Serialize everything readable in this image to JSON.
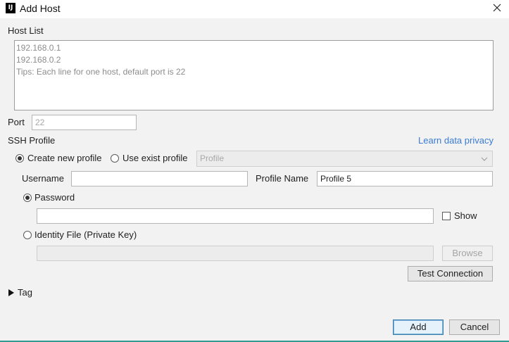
{
  "window": {
    "title": "Add Host",
    "app_icon_text": "IJ",
    "close_icon": "close-icon"
  },
  "host_list": {
    "label": "Host List",
    "lines": [
      "192.168.0.1",
      "192.168.0.2",
      "Tips: Each line for one host, default port is 22"
    ]
  },
  "port": {
    "label": "Port",
    "placeholder": "22"
  },
  "ssh_profile": {
    "label": "SSH Profile",
    "learn_link": "Learn data privacy",
    "create_new_label": "Create new profile",
    "create_new_selected": true,
    "use_exist_label": "Use exist profile",
    "use_exist_selected": false,
    "profile_select_value": "Profile"
  },
  "username": {
    "label": "Username",
    "value": ""
  },
  "profile_name": {
    "label": "Profile Name",
    "value": "Profile 5"
  },
  "auth": {
    "password_label": "Password",
    "password_selected": true,
    "password_value": "",
    "show_label": "Show",
    "show_checked": false,
    "identity_label": "Identity File (Private Key)",
    "identity_selected": false,
    "browse_label": "Browse"
  },
  "test_connection_label": "Test Connection",
  "tag": {
    "label": "Tag",
    "expanded": false
  },
  "footer": {
    "add_label": "Add",
    "cancel_label": "Cancel"
  }
}
